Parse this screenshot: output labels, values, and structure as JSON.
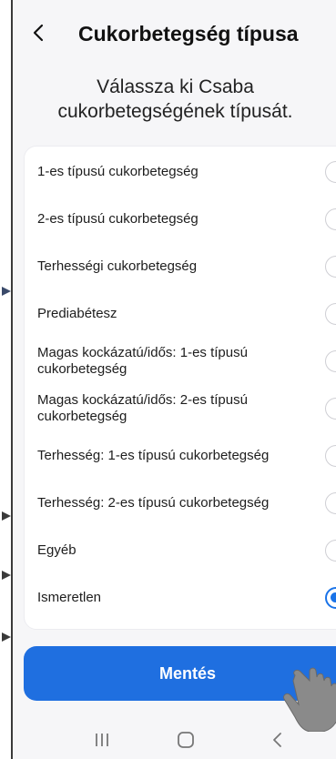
{
  "header": {
    "title": "Cukorbetegség típusa"
  },
  "subtitle": {
    "line1": "Válassza ki Csaba",
    "line2": "cukorbetegségének típusát."
  },
  "options": [
    {
      "label": "1-es típusú cukorbetegség",
      "checked": false
    },
    {
      "label": "2-es típusú cukorbetegség",
      "checked": false
    },
    {
      "label": "Terhességi cukorbetegség",
      "checked": false
    },
    {
      "label": "Prediabétesz",
      "checked": false
    },
    {
      "label": "Magas kockázatú/idős: 1-es típusú cukorbetegség",
      "checked": false
    },
    {
      "label": "Magas kockázatú/idős: 2-es típusú cukorbetegség",
      "checked": false
    },
    {
      "label": "Terhesség: 1-es típusú cukorbetegség",
      "checked": false
    },
    {
      "label": "Terhesség: 2-es típusú cukorbetegség",
      "checked": false
    },
    {
      "label": "Egyéb",
      "checked": false
    },
    {
      "label": "Ismeretlen",
      "checked": true
    }
  ],
  "save_button": {
    "label": "Mentés"
  },
  "colors": {
    "accent": "#1f6fe0",
    "radio_selected": "#1a73e8"
  }
}
